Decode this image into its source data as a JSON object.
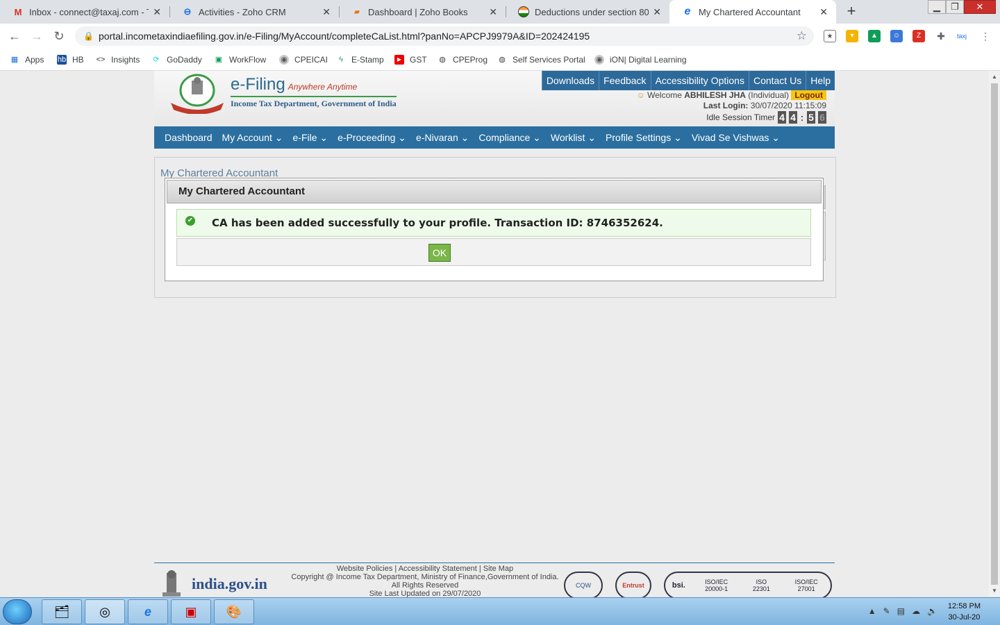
{
  "browser": {
    "tabs": [
      {
        "title": "Inbox - connect@taxaj.com - Tax",
        "icon": "gmail-icon",
        "active": false
      },
      {
        "title": "Activities - Zoho CRM",
        "icon": "zoho-crm-icon",
        "active": false
      },
      {
        "title": "Dashboard | Zoho Books",
        "icon": "zoho-books-icon",
        "active": false
      },
      {
        "title": "Deductions under section 80",
        "icon": "india-flag-icon",
        "active": false
      },
      {
        "title": "My Chartered Accountant",
        "icon": "ie-icon",
        "active": true
      }
    ],
    "new_tab": "+",
    "url": "portal.incometaxindiaefiling.gov.in/e-Filing/MyAccount/completeCaList.html?panNo=APCPJ9979A&ID=202424195"
  },
  "bookmarks": [
    {
      "label": "Apps"
    },
    {
      "label": "HB"
    },
    {
      "label": "Insights"
    },
    {
      "label": "GoDaddy"
    },
    {
      "label": "WorkFlow"
    },
    {
      "label": "CPEICAI"
    },
    {
      "label": "E-Stamp"
    },
    {
      "label": "GST"
    },
    {
      "label": "CPEProg"
    },
    {
      "label": "Self Services Portal"
    },
    {
      "label": "iON| Digital Learning"
    }
  ],
  "site": {
    "brand": "e-Filing",
    "tagline": "Anywhere Anytime",
    "dept": "Income Tax Department, Government of India",
    "top_menu": [
      "Downloads",
      "Feedback",
      "Accessibility Options",
      "Contact Us",
      "Help"
    ],
    "welcome_prefix": "Welcome",
    "user": "ABHILESH JHA",
    "user_type": "(Individual)",
    "logout": "Logout",
    "last_login_label": "Last Login:",
    "last_login": "30/07/2020 11:15:09",
    "idle_label": "Idle Session Timer",
    "timer_digits": [
      "4",
      "4",
      ":",
      "5",
      "6"
    ],
    "main_nav": [
      "Dashboard",
      "My Account ⌄",
      "e-File ⌄",
      "e-Proceeding ⌄",
      "e-Nivaran ⌄",
      "Compliance ⌄",
      "Worklist ⌄",
      "Profile Settings ⌄",
      "Vivad Se Vishwas ⌄"
    ],
    "breadcrumb": "My Chartered Accountant"
  },
  "dialog": {
    "title": "My Chartered Accountant",
    "message": "CA has been added successfully to your profile. Transaction ID: 8746352624.",
    "ok": "OK"
  },
  "footer": {
    "india_gov": "india.gov.in",
    "links": "Website Policies  |  Accessibility Statement  |  Site Map",
    "copyright": "Copyright @ Income Tax Department, Ministry of Finance,Government of India.",
    "rights": "All Rights Reserved",
    "updated": "Site Last Updated on 29/07/2020",
    "badges": [
      "CQW",
      "Entrust",
      "ISO/IEC 20000-1",
      "ISO 22301",
      "ISO/IEC 27001"
    ]
  },
  "taskbar": {
    "time": "12:58 PM",
    "date": "30-Jul-20"
  }
}
